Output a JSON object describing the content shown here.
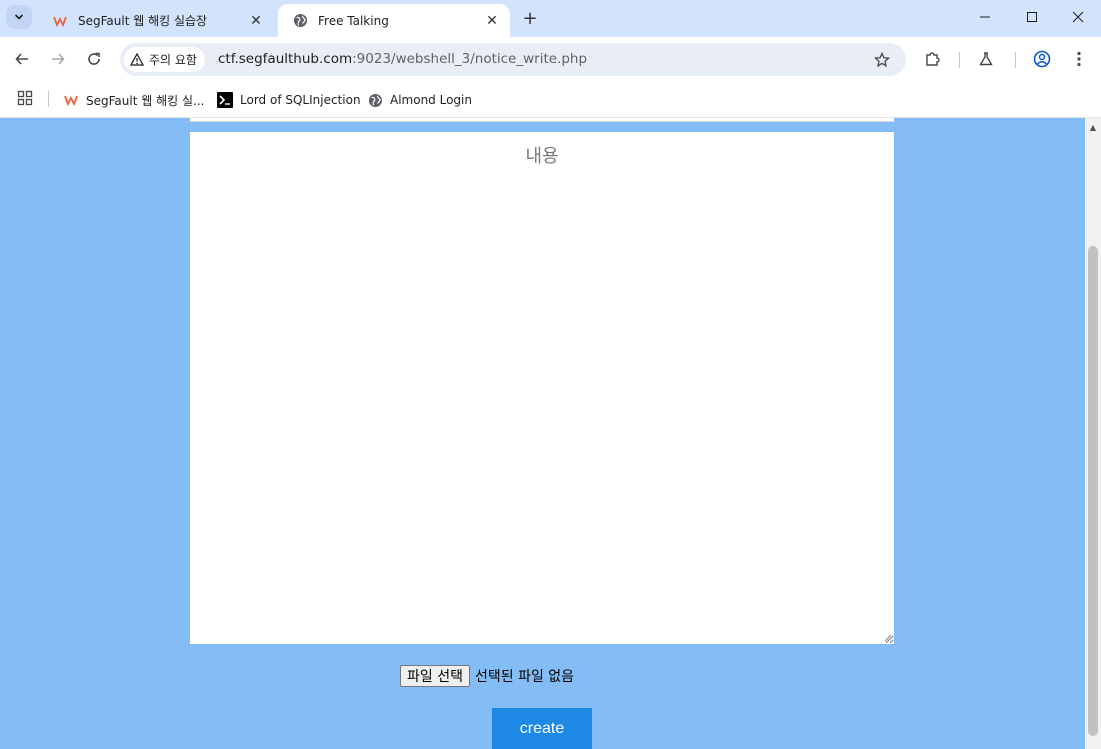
{
  "tabs": [
    {
      "title": "SegFault 웹 해킹 실습장",
      "active": false,
      "favicon": "segfault-logo-icon"
    },
    {
      "title": "Free Talking",
      "active": true,
      "favicon": "globe-icon"
    }
  ],
  "toolbar": {
    "security_label": "주의 요함",
    "url_host": "ctf.segfaulthub.com",
    "url_path": ":9023/webshell_3/notice_write.php"
  },
  "bookmarks": [
    {
      "label": "SegFault 웹 해킹 실...",
      "icon": "segfault-logo-icon"
    },
    {
      "label": "Lord of SQLInjection",
      "icon": "terminal-icon"
    },
    {
      "label": "Almond Login",
      "icon": "globe-icon"
    }
  ],
  "form": {
    "content_placeholder": "내용",
    "file_button_label": "파일 선택",
    "file_status": "선택된 파일 없음",
    "submit_label": "create"
  },
  "colors": {
    "page_background": "#84bdf5",
    "submit_button": "#1e88e5",
    "tabstrip": "#d3e3fd"
  }
}
